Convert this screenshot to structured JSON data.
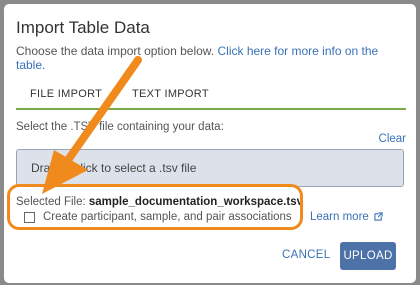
{
  "dialog": {
    "title": "Import Table Data",
    "description": "Choose the data import option below.",
    "info_link": "Click here for more info on the table.",
    "tabs": [
      {
        "label": "FILE IMPORT",
        "active": true
      },
      {
        "label": "TEXT IMPORT",
        "active": false
      }
    ],
    "instruction": "Select the .TSV file containing your data:",
    "clear_label": "Clear",
    "dropzone_text": "Drag or click to select a .tsv file",
    "selected_file_label": "Selected File:",
    "selected_file_name": "sample_documentation_workspace.tsv",
    "associations_label": "Create participant, sample, and pair associations",
    "learn_more_label": "Learn more",
    "cancel_label": "CANCEL",
    "upload_label": "UPLOAD"
  },
  "colors": {
    "accent": "#3a72b8",
    "tab_underline": "#7aa84b",
    "annotation": "#f08a1c",
    "upload_button": "#4d72a8"
  },
  "icons": [
    "external-link-icon",
    "annotation-arrow-icon"
  ]
}
